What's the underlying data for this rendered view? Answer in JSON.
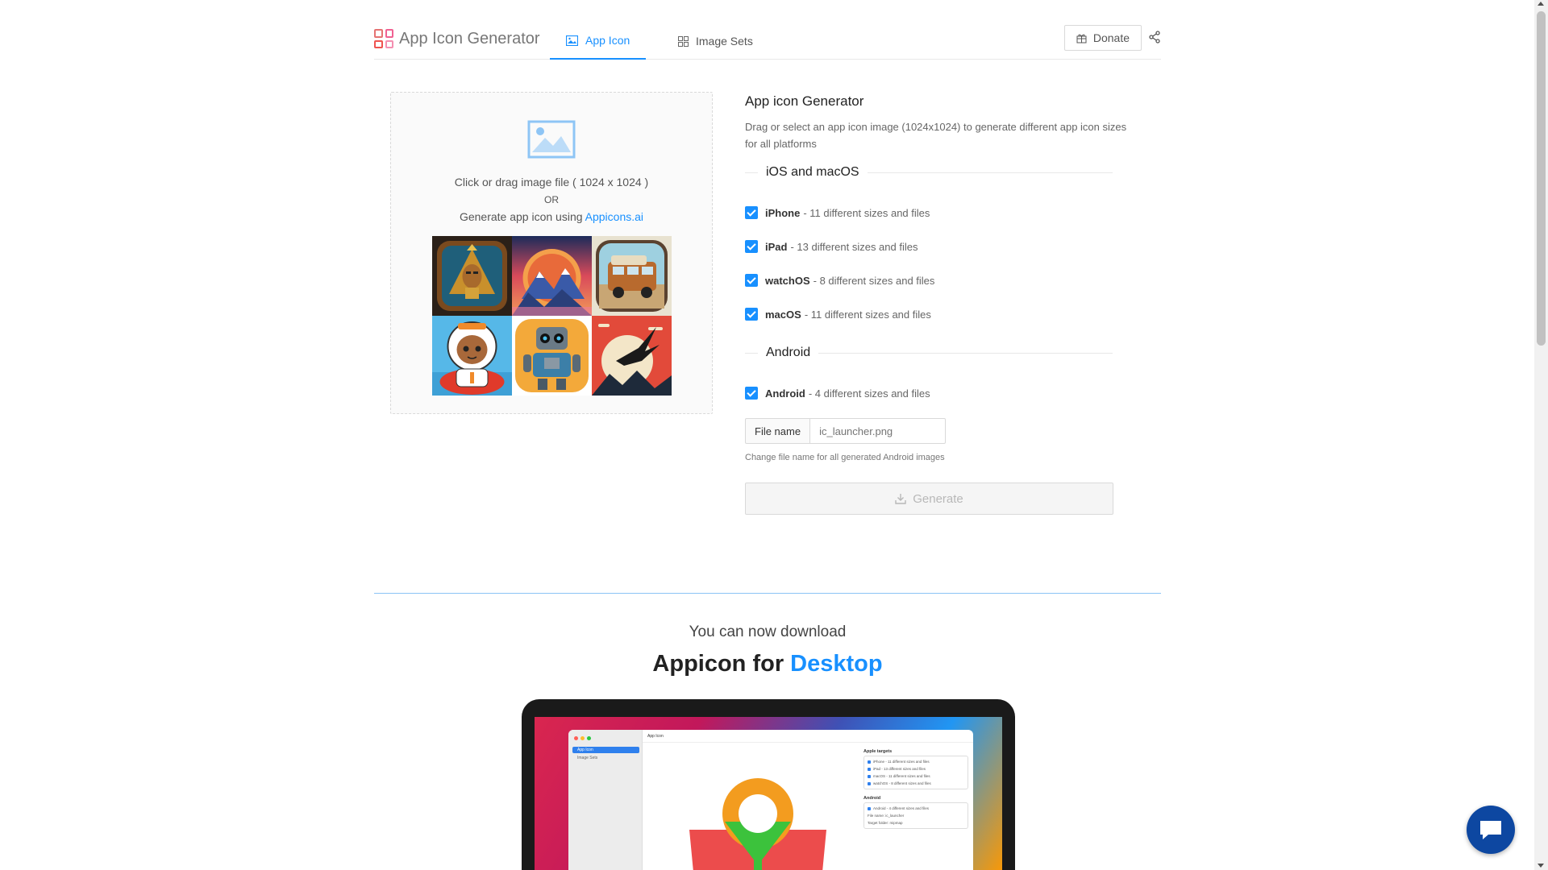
{
  "header": {
    "brand_title": "App Icon Generator",
    "tabs": [
      {
        "label": "App Icon",
        "active": true,
        "icon": "image-icon"
      },
      {
        "label": "Image Sets",
        "active": false,
        "icon": "grid-icon"
      }
    ],
    "donate_label": "Donate",
    "accent_color": "#1890ff"
  },
  "upload": {
    "line1": "Click or drag image file ( 1024 x 1024 )",
    "or": "OR",
    "line2_prefix": "Generate app icon using ",
    "line2_link": "Appicons.ai"
  },
  "panel": {
    "title": "App icon Generator",
    "description": "Drag or select an app icon image (1024x1024) to generate different app icon sizes for all platforms",
    "ios_section": "iOS and macOS",
    "android_section": "Android",
    "options": [
      {
        "name": "iPhone",
        "desc": "- 11 different sizes and files",
        "checked": true
      },
      {
        "name": "iPad",
        "desc": "- 13 different sizes and files",
        "checked": true
      },
      {
        "name": "watchOS",
        "desc": "- 8 different sizes and files",
        "checked": true
      },
      {
        "name": "macOS",
        "desc": "- 11 different sizes and files",
        "checked": true
      },
      {
        "name": "Android",
        "desc": "- 4 different sizes and files",
        "checked": true
      }
    ],
    "filename_label": "File name",
    "filename_placeholder": "ic_launcher.png",
    "filename_help": "Change file name for all generated Android images",
    "generate_label": "Generate"
  },
  "promo": {
    "subtitle": "You can now download",
    "title_prefix": "Appicon for ",
    "title_highlight": "Desktop"
  },
  "mockup": {
    "side_selected": "App Icon",
    "side_item": "Image Sets",
    "header": "App Icon",
    "apple_targets": "Apple targets",
    "android": "Android",
    "rows": [
      "iPhone - 11 different sizes and files",
      "iPad - 13 different sizes and files",
      "macOS - 11 different sizes and files",
      "watchOS - 8 different sizes and files"
    ],
    "android_row": "Android - 4 different sizes and files",
    "file_name_row": "File name: ic_launcher",
    "target_folder_row": "Target folder: mipmap"
  }
}
